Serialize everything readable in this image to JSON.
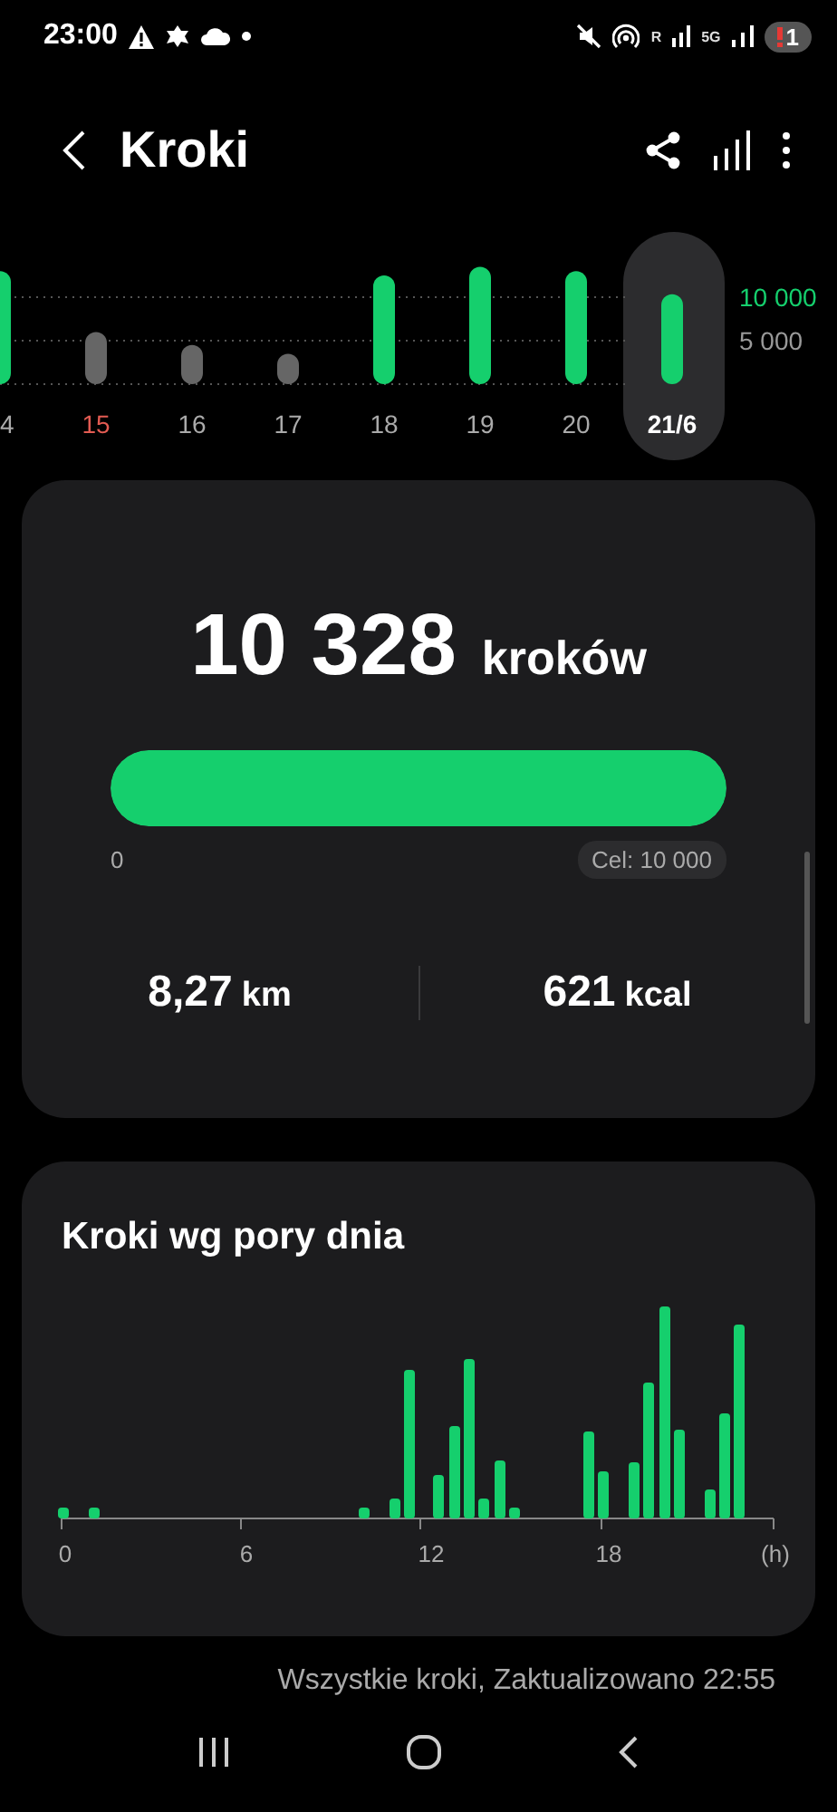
{
  "status_bar": {
    "time": "23:00",
    "network_labels": [
      "R",
      "5G"
    ],
    "notification_count": "1"
  },
  "header": {
    "title": "Kroki"
  },
  "daily_chart": {
    "chart_data": {
      "type": "bar",
      "categories": [
        "4",
        "15",
        "16",
        "17",
        "18",
        "19",
        "20",
        "21/6"
      ],
      "values": [
        13000,
        6000,
        4500,
        3500,
        12500,
        13500,
        13000,
        10328
      ],
      "ylim": [
        0,
        14000
      ],
      "yticks": [
        {
          "value": 5000,
          "label": "5 000"
        },
        {
          "value": 10000,
          "label": "10 000"
        }
      ]
    },
    "days": [
      {
        "sunday": false,
        "selected": false
      },
      {
        "sunday": true,
        "selected": false
      },
      {
        "sunday": false,
        "selected": false
      },
      {
        "sunday": false,
        "selected": false
      },
      {
        "sunday": false,
        "selected": false
      },
      {
        "sunday": false,
        "selected": false
      },
      {
        "sunday": false,
        "selected": false
      },
      {
        "sunday": false,
        "selected": true
      }
    ]
  },
  "summary": {
    "steps": "10 328",
    "steps_unit": "kroków",
    "level": 1,
    "min_label": "0",
    "goal_label": "Cel: 10 000",
    "distance": "8,27",
    "distance_unit": "km",
    "energy": "621",
    "energy_unit": "kcal"
  },
  "hourly": {
    "title": "Kroki wg pory dnia",
    "axis_labels": [
      "0",
      "6",
      "12",
      "18",
      "(h)"
    ]
  },
  "footer": "Wszystkie kroki, Zaktualizowano 22:55"
}
